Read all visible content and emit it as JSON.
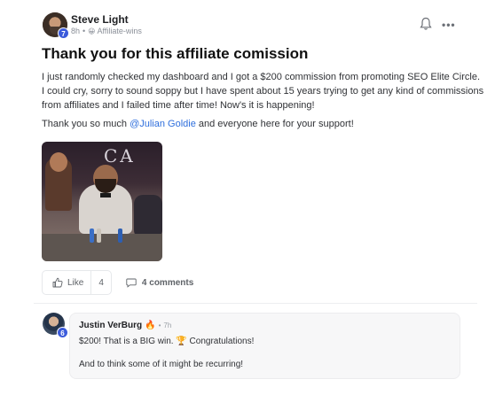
{
  "post": {
    "author": "Steve Light",
    "level": "7",
    "time": "8h",
    "separator": "•",
    "category_emoji": "😀",
    "category": "Affiliate-wins",
    "title": "Thank you for this affiliate comission",
    "body": "I just randomly checked my dashboard and I got a $200 commission from promoting SEO Elite Circle. I could cry, sorry to supid sound soppy but I have spent about 15 years trying to get any kind of commissions from affiliates and I failed time after time! Now's it is happening!",
    "thanks_prefix": "Thank you so much ",
    "mention": "@Julian Goldie",
    "thanks_suffix": " and everyone here for your support!",
    "more_glyph": "•••",
    "icons": {
      "bell": "bell-icon",
      "more": "more-icon",
      "like": "thumbs-up-icon",
      "comment": "comment-icon"
    }
  },
  "actions": {
    "like_label": "Like",
    "like_count": "4",
    "comments_label": "4 comments"
  },
  "comment": {
    "author": "Justin VerBurg",
    "badge_emoji": "🔥",
    "separator": "•",
    "time": "7h",
    "level": "6",
    "line1": "$200! That is a BIG win. 🏆 Congratulations!",
    "line2": "And to think some of it might be recurring!"
  },
  "colors": {
    "mention": "#2f6fdd",
    "level_badge": "#3b5bdb"
  }
}
